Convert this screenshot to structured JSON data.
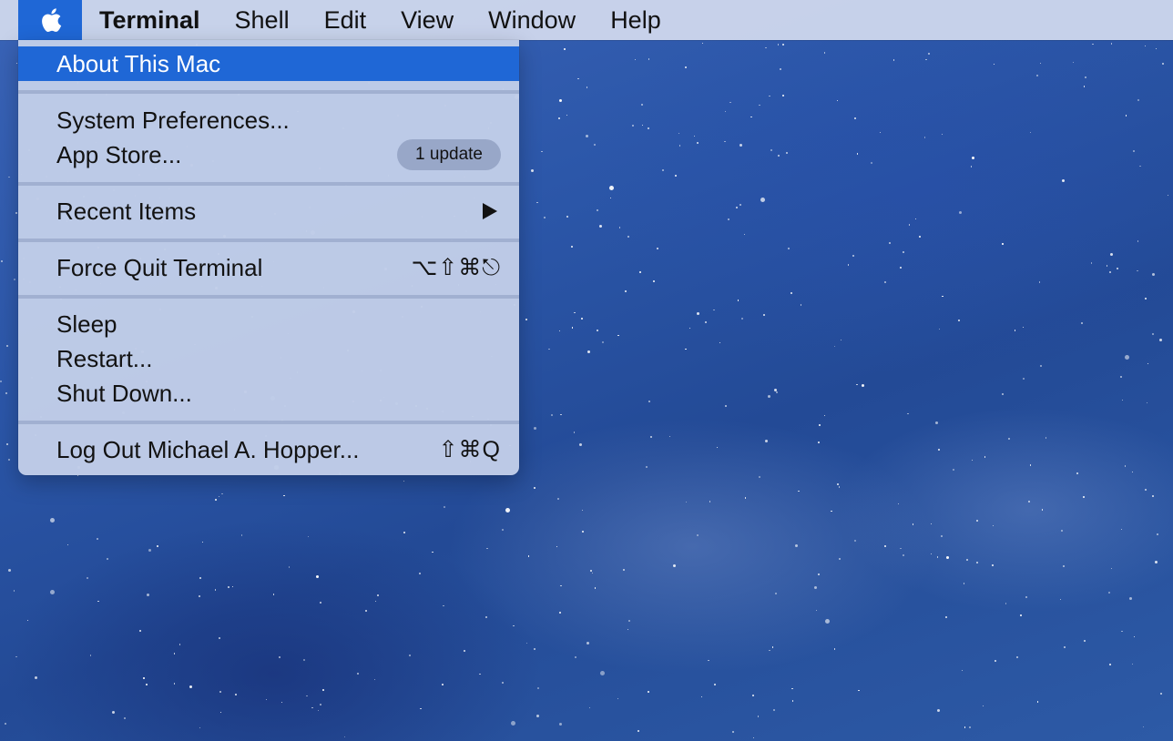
{
  "menubar": {
    "apple_icon": "apple-logo-icon",
    "items": [
      "Terminal",
      "Shell",
      "Edit",
      "View",
      "Window",
      "Help"
    ]
  },
  "apple_menu": {
    "about": "About This Mac",
    "system_preferences": "System Preferences...",
    "app_store": "App Store...",
    "app_store_badge": "1 update",
    "recent_items": "Recent Items",
    "recent_items_icon": "submenu-arrow-icon",
    "force_quit": "Force Quit Terminal",
    "force_quit_shortcut": "⌥⇧⌘⎋",
    "sleep": "Sleep",
    "restart": "Restart...",
    "shut_down": "Shut Down...",
    "log_out": "Log Out Michael A. Hopper...",
    "log_out_shortcut": "⇧⌘Q"
  },
  "colors": {
    "highlight": "#1f67d6",
    "menubar": "#cdd6ec",
    "menu_background": "#c1cde8",
    "wallpaper": "#2b56a8"
  }
}
